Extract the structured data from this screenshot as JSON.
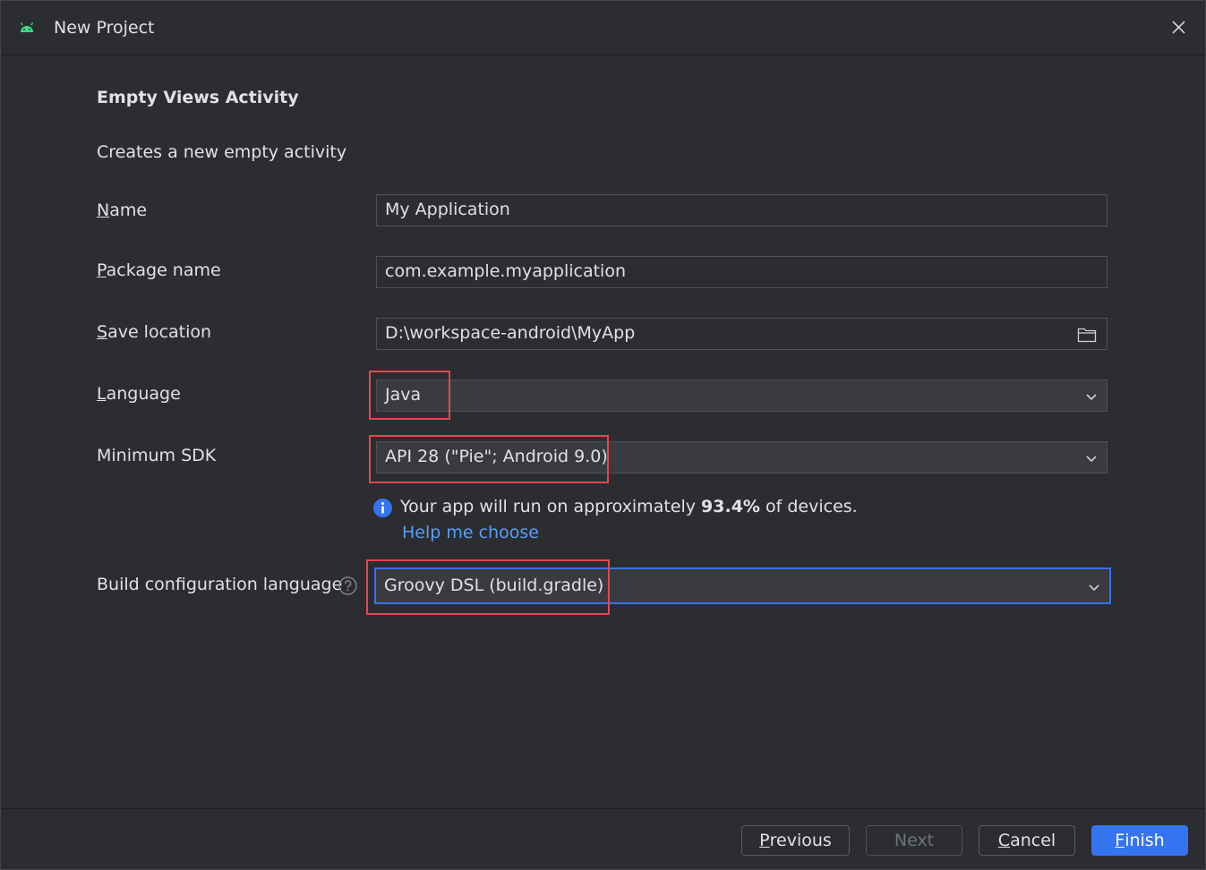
{
  "window": {
    "title": "New Project",
    "icon": "android-icon"
  },
  "template": {
    "heading": "Empty Views Activity",
    "description": "Creates a new empty activity"
  },
  "form": {
    "name": {
      "label_mn": "N",
      "label_rest": "ame",
      "value": "My Application"
    },
    "package": {
      "label_mn": "P",
      "label_rest": "ackage name",
      "value": "com.example.myapplication"
    },
    "save_location": {
      "label_mn": "S",
      "label_rest": "ave location",
      "value": "D:\\workspace-android\\MyApp"
    },
    "language": {
      "label_mn": "L",
      "label_rest": "anguage",
      "value": "Java"
    },
    "min_sdk": {
      "label": "Minimum SDK",
      "value": "API 28 (\"Pie\"; Android 9.0)"
    },
    "build_config": {
      "label": "Build configuration language",
      "value": "Groovy DSL (build.gradle)"
    }
  },
  "info": {
    "prefix": "Your app will run on approximately ",
    "percent": "93.4%",
    "suffix": " of devices.",
    "help_link": "Help me choose"
  },
  "buttons": {
    "previous": {
      "mn": "P",
      "rest": "revious"
    },
    "next": "Next",
    "cancel": {
      "mn": "C",
      "rest": "ancel"
    },
    "finish": {
      "mn": "F",
      "rest": "inish"
    }
  },
  "colors": {
    "background": "#2b2d30",
    "accent": "#3574f0",
    "link": "#589df6",
    "highlight": "#e5474d"
  }
}
